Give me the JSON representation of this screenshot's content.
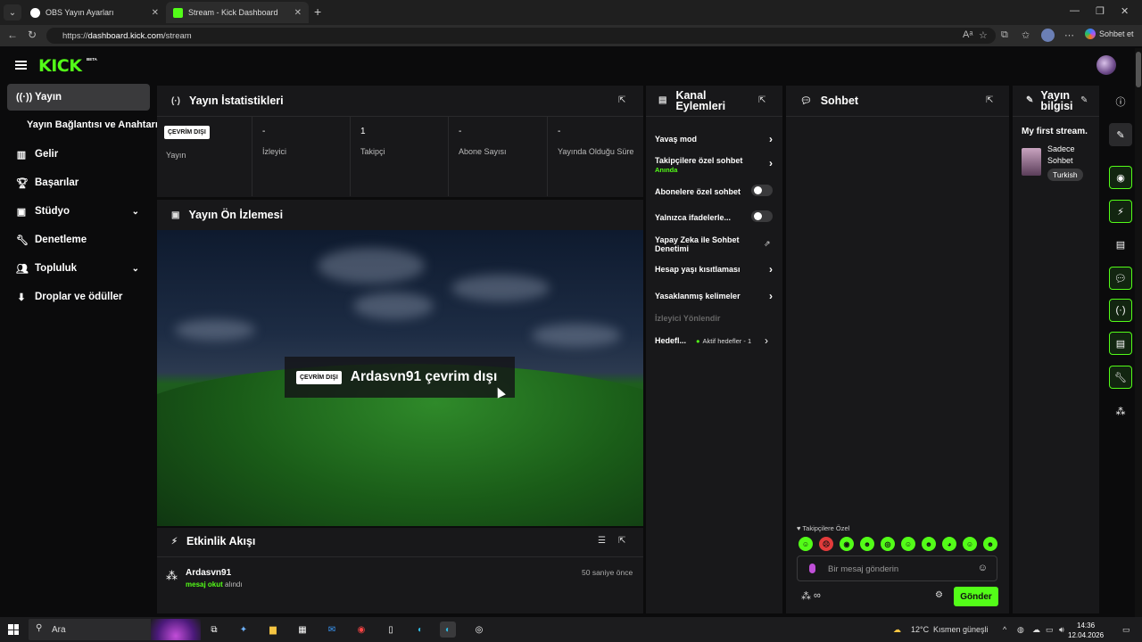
{
  "browser": {
    "tabs": [
      {
        "title": "OBS Yayın Ayarları",
        "active": false
      },
      {
        "title": "Stream - Kick Dashboard",
        "active": true
      }
    ],
    "url_prefix": "https://",
    "url_host": "dashboard.kick.com",
    "url_path": "/stream",
    "copilot_label": "Sohbet et"
  },
  "kick": {
    "logo": "KICK",
    "beta": "BETA"
  },
  "sidebar": {
    "items": [
      {
        "label": "Yayın",
        "icon": "broadcast-icon",
        "active": true
      },
      {
        "label": "Gelir",
        "icon": "chart-icon"
      },
      {
        "label": "Başarılar",
        "icon": "trophy-icon"
      },
      {
        "label": "Stüdyo",
        "icon": "studio-icon",
        "expandable": true
      },
      {
        "label": "Denetleme",
        "icon": "wrench-icon"
      },
      {
        "label": "Topluluk",
        "icon": "community-icon",
        "expandable": true
      },
      {
        "label": "Droplar ve ödüller",
        "icon": "drops-icon"
      }
    ],
    "subitem": "Yayın Bağlantısı ve Anahtarı"
  },
  "stats": {
    "title": "Yayın İstatistikleri",
    "badge": "ÇEVRİM DIŞI",
    "badge_label": "Yayın",
    "cells": [
      {
        "value": "-",
        "label": "İzleyici"
      },
      {
        "value": "1",
        "label": "Takipçi"
      },
      {
        "value": "-",
        "label": "Abone Sayısı"
      },
      {
        "value": "-",
        "label": "Yayında Olduğu Süre"
      }
    ]
  },
  "preview": {
    "title": "Yayın Ön İzlemesi",
    "badge": "ÇEVRİM DIŞI",
    "offline_text": "Ardasvn91 çevrim dışı"
  },
  "activity": {
    "title": "Etkinlik Akışı",
    "events": [
      {
        "user": "Ardasvn91",
        "highlight": "mesaj okut",
        "suffix": "alındı",
        "time": "50 saniye önce"
      }
    ]
  },
  "channel_actions": {
    "title": "Kanal Eylemleri",
    "items": [
      {
        "label": "Yavaş mod",
        "control": "arrow"
      },
      {
        "label": "Takipçilere özel sohbet",
        "sub": "Anında",
        "control": "arrow"
      },
      {
        "label": "Abonelere özel sohbet",
        "control": "toggle"
      },
      {
        "label": "Yalnızca ifadelerle...",
        "control": "toggle"
      },
      {
        "label": "Yapay Zeka ile Sohbet Denetimi",
        "control": "external"
      },
      {
        "label": "Hesap yaşı kısıtlaması",
        "control": "arrow"
      },
      {
        "label": "Yasaklanmış kelimeler",
        "control": "arrow"
      }
    ],
    "disabled_item": "İzleyici Yönlendir",
    "goals_label": "Hedefl...",
    "goals_sub": "Aktif hedefler - 1"
  },
  "chat": {
    "title": "Sohbet",
    "followers_only": "Takipçilere Özel",
    "input_placeholder": "Bir mesaj gönderin",
    "send_label": "Gönder"
  },
  "stream_info": {
    "title": "Yayın bilgisi",
    "stream_title": "My first stream.",
    "category": "Sadece Sohbet",
    "tag": "Turkish"
  },
  "taskbar": {
    "search_placeholder": "Ara",
    "weather": "12°C",
    "weather_desc": "Kısmen güneşli",
    "time": "14:36",
    "date": "12.04.2026"
  },
  "colors": {
    "accent": "#53fc18",
    "panel": "#18181a",
    "bg": "#0b0b0c"
  }
}
